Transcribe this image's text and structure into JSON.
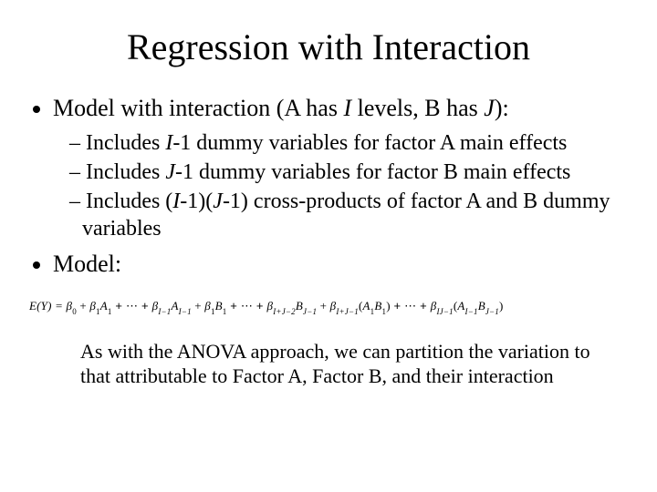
{
  "title": "Regression with Interaction",
  "bullets": {
    "b1_pre": "Model with interaction (A has ",
    "b1_I": "I",
    "b1_mid": " levels, B has ",
    "b1_J": "J",
    "b1_post": "):",
    "s1_pre": "Includes ",
    "s1_I": "I",
    "s1_post": "-1 dummy variables for factor A main effects",
    "s2_pre": "Includes ",
    "s2_J": "J",
    "s2_post": "-1 dummy variables for factor B main effects",
    "s3_pre": "Includes (",
    "s3_I": "I",
    "s3_mid1": "-1)(",
    "s3_J": "J",
    "s3_post": "-1) cross-products of factor A and B dummy variables",
    "b2": "Model:"
  },
  "equation": {
    "lhs": "E(Y) = ",
    "b0": "β",
    "b0s": "0",
    "plus": " + ",
    "b1": "β",
    "b1s": "1",
    "A1": "A",
    "A1s": "1",
    "ell": " + ⋯ + ",
    "bi1": "β",
    "bi1s": "I−1",
    "Ai1": "A",
    "Ai1s": "I−1",
    "bj1": "β",
    "bj1s": "1",
    "B1": "B",
    "B1s": "1",
    "bijm": "β",
    "bijms": "I+J−2",
    "Bjm": "B",
    "Bjms": "J−1",
    "bix": "β",
    "bixs": "I+J−1",
    "open": "(",
    "close": ")",
    "Ax1": "A",
    "Ax1s": "1",
    "Bx1": "B",
    "Bx1s": "1",
    "blast": "β",
    "blasts": "IJ−1",
    "Axl": "A",
    "Axls": "I−1",
    "Bxl": "B",
    "Bxls": "J−1"
  },
  "closing": "As with the ANOVA approach, we can partition the variation to that attributable to Factor A, Factor B, and their interaction"
}
